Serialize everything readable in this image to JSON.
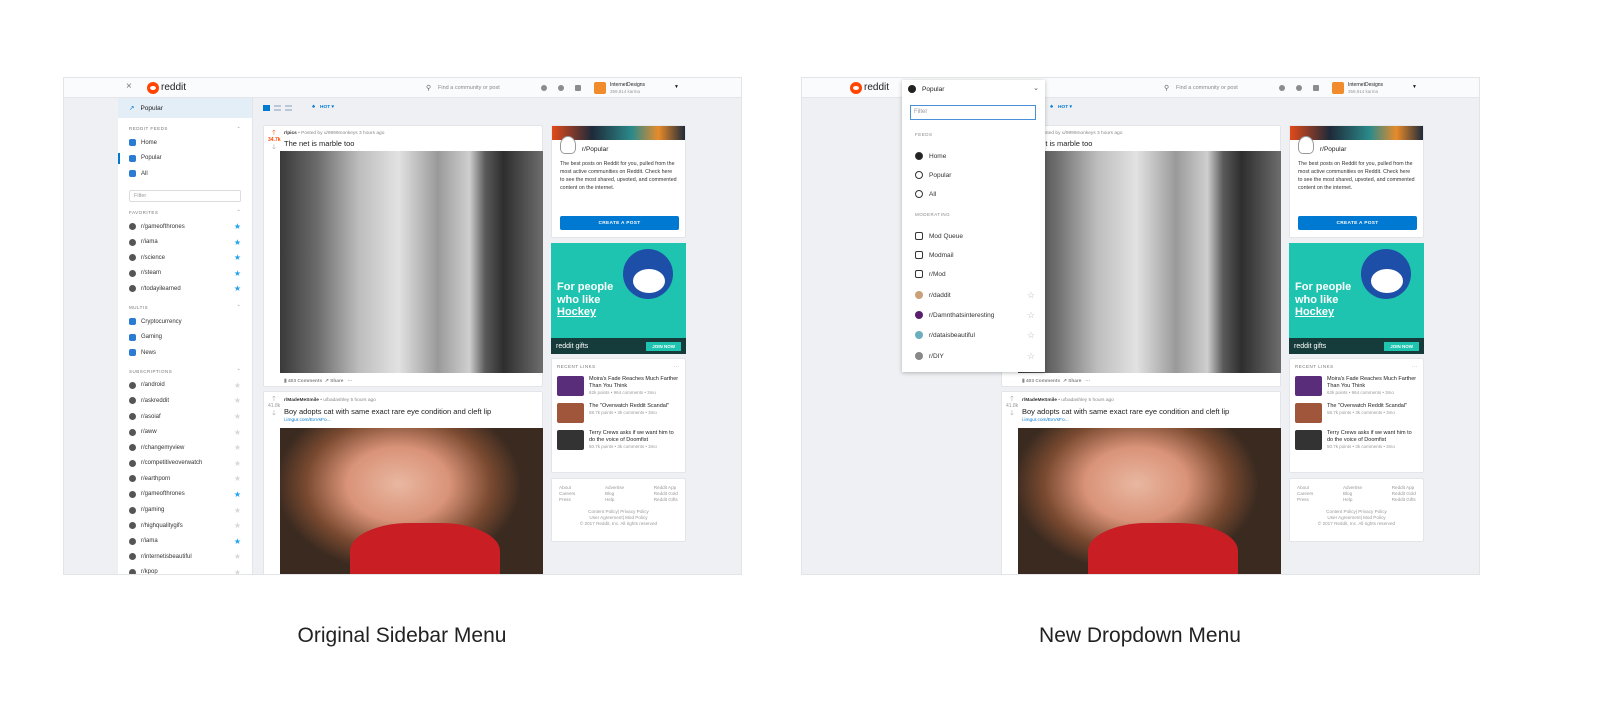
{
  "captions": {
    "left": "Original Sidebar Menu",
    "right": "New Dropdown Menu"
  },
  "header": {
    "logo_text": "reddit",
    "search_placeholder": "Find a community or post",
    "username": "InternetDesigns",
    "karma": "359,914 karma"
  },
  "toolbar": {
    "sort_label": "HOT"
  },
  "sidebar": {
    "current": "Popular",
    "filter_placeholder": "Filter",
    "sections": [
      {
        "label": "REDDIT FEEDS",
        "items": [
          {
            "label": "Home",
            "icon": "home-icon"
          },
          {
            "label": "Popular",
            "icon": "trending-icon",
            "active": true
          },
          {
            "label": "All",
            "icon": "chart-icon"
          }
        ],
        "filter": true
      },
      {
        "label": "FAVORITES",
        "items": [
          {
            "label": "r/gameofthrones",
            "star": true
          },
          {
            "label": "r/iama",
            "star": true
          },
          {
            "label": "r/science",
            "star": true
          },
          {
            "label": "r/steam",
            "star": true
          },
          {
            "label": "r/todayilearned",
            "star": true
          }
        ]
      },
      {
        "label": "MULTIS",
        "items": [
          {
            "label": "Cryptocurrency"
          },
          {
            "label": "Gaming"
          },
          {
            "label": "News"
          }
        ]
      },
      {
        "label": "SUBSCRIPTIONS",
        "items": [
          {
            "label": "r/android",
            "star": false
          },
          {
            "label": "r/askreddit",
            "star": false
          },
          {
            "label": "r/asoiaf",
            "star": false
          },
          {
            "label": "r/aww",
            "star": false
          },
          {
            "label": "r/changemyview",
            "star": false
          },
          {
            "label": "r/competitiveoverwatch",
            "star": false
          },
          {
            "label": "r/earthporn",
            "star": false
          },
          {
            "label": "r/gameofthrones",
            "star": true
          },
          {
            "label": "r/gaming",
            "star": false
          },
          {
            "label": "r/highqualitygifs",
            "star": false
          },
          {
            "label": "r/iama",
            "star": true
          },
          {
            "label": "r/internetisbeautiful",
            "star": false
          },
          {
            "label": "r/kpop",
            "star": false
          }
        ]
      }
    ]
  },
  "dropdown": {
    "current": "Popular",
    "filter_placeholder": "Filter",
    "feeds_label": "FEEDS",
    "feeds": [
      "Home",
      "Popular",
      "All"
    ],
    "moderating_label": "MODERATING",
    "moderating": [
      "Mod Queue",
      "Modmail",
      "r/Mod"
    ],
    "communities": [
      "r/daddit",
      "r/Damnthatsinteresting",
      "r/dataisbeautiful",
      "r/DIY"
    ]
  },
  "posts": [
    {
      "subreddit": "r/pics",
      "meta": "• Posted by u/9999monkeys 3 hours ago",
      "score": "34.7k",
      "title": "The net is marble too",
      "comments": "403 Comments",
      "share": "Share",
      "more": "···"
    },
    {
      "subreddit": "r/MadeMeSmile",
      "meta": "• u/badashley 5 hours ago",
      "score": "41.8k",
      "title": "Boy adopts cat with same exact rare eye condition and cleft lip",
      "link": "i.imgur.com/ExVsFo..."
    }
  ],
  "community_card": {
    "name": "r/Popular",
    "description": "The best posts on Reddit for you, pulled from the most active communities on Reddit. Check here to see the most shared, upvoted, and commented content on the internet.",
    "button": "CREATE A POST"
  },
  "ad": {
    "line1": "For people",
    "line2": "who like",
    "line3": "Hockey",
    "brand": "reddit gifts",
    "cta": "JOIN NOW"
  },
  "recent_links": {
    "label": "RECENT LINKS",
    "more": "···",
    "items": [
      {
        "title": "Moira's Fade Reaches Much Farther Than You Think",
        "meta": "62k points • 964 comments • 3mo",
        "color": "#5a2d7a"
      },
      {
        "title": "The \"Overwatch Reddit Scandal\"",
        "meta": "58.7k points • 3k comments • 3mo",
        "color": "#a0563a"
      },
      {
        "title": "Terry Crews asks if we want him to do the voice of Doomfist",
        "meta": "50.7k points • 3k comments • 3mo",
        "color": "#333333"
      }
    ]
  },
  "footer": {
    "col1": [
      "About",
      "Careers",
      "Press"
    ],
    "col2": [
      "Advertise",
      "Blog",
      "Help"
    ],
    "col3": [
      "Reddit App",
      "Reddit Gold",
      "Reddit Gifts"
    ],
    "policy1": "Content Policy| Privacy Policy",
    "policy2": "User Agreement| Mod Policy",
    "copyright": "© 2017 Reddit, Inc. All rights reserved"
  }
}
